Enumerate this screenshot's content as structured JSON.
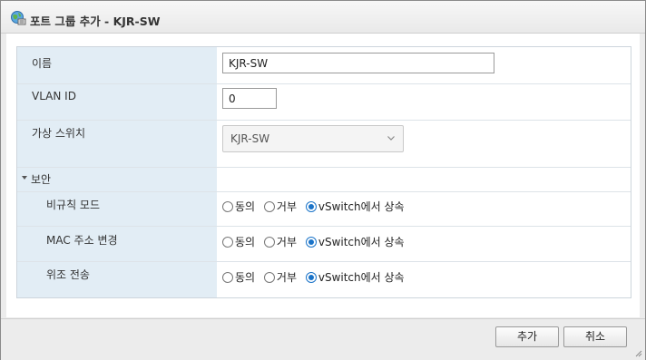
{
  "dialog": {
    "title": "포트 그룹 추가 - KJR-SW"
  },
  "form": {
    "name": {
      "label": "이름",
      "value": "KJR-SW"
    },
    "vlan": {
      "label": "VLAN ID",
      "value": "0"
    },
    "vswitch": {
      "label": "가상 스위치",
      "selected": "KJR-SW"
    },
    "security": {
      "label": "보안",
      "rows": [
        {
          "label": "비규칙 모드",
          "options": [
            "동의",
            "거부",
            "vSwitch에서 상속"
          ],
          "selected": "vSwitch에서 상속"
        },
        {
          "label": "MAC 주소 변경",
          "options": [
            "동의",
            "거부",
            "vSwitch에서 상속"
          ],
          "selected": "vSwitch에서 상속"
        },
        {
          "label": "위조 전송",
          "options": [
            "동의",
            "거부",
            "vSwitch에서 상속"
          ],
          "selected": "vSwitch에서 상속"
        }
      ]
    }
  },
  "footer": {
    "add_label": "추가",
    "cancel_label": "취소"
  },
  "colors": {
    "label_column": "#e2edf5",
    "radio_accent": "#1a73c8"
  },
  "icons": {
    "title": "network-globe-icon",
    "dropdown": "chevron-down-icon",
    "section_toggle": "caret-down-icon",
    "resize": "resize-grip-icon"
  }
}
